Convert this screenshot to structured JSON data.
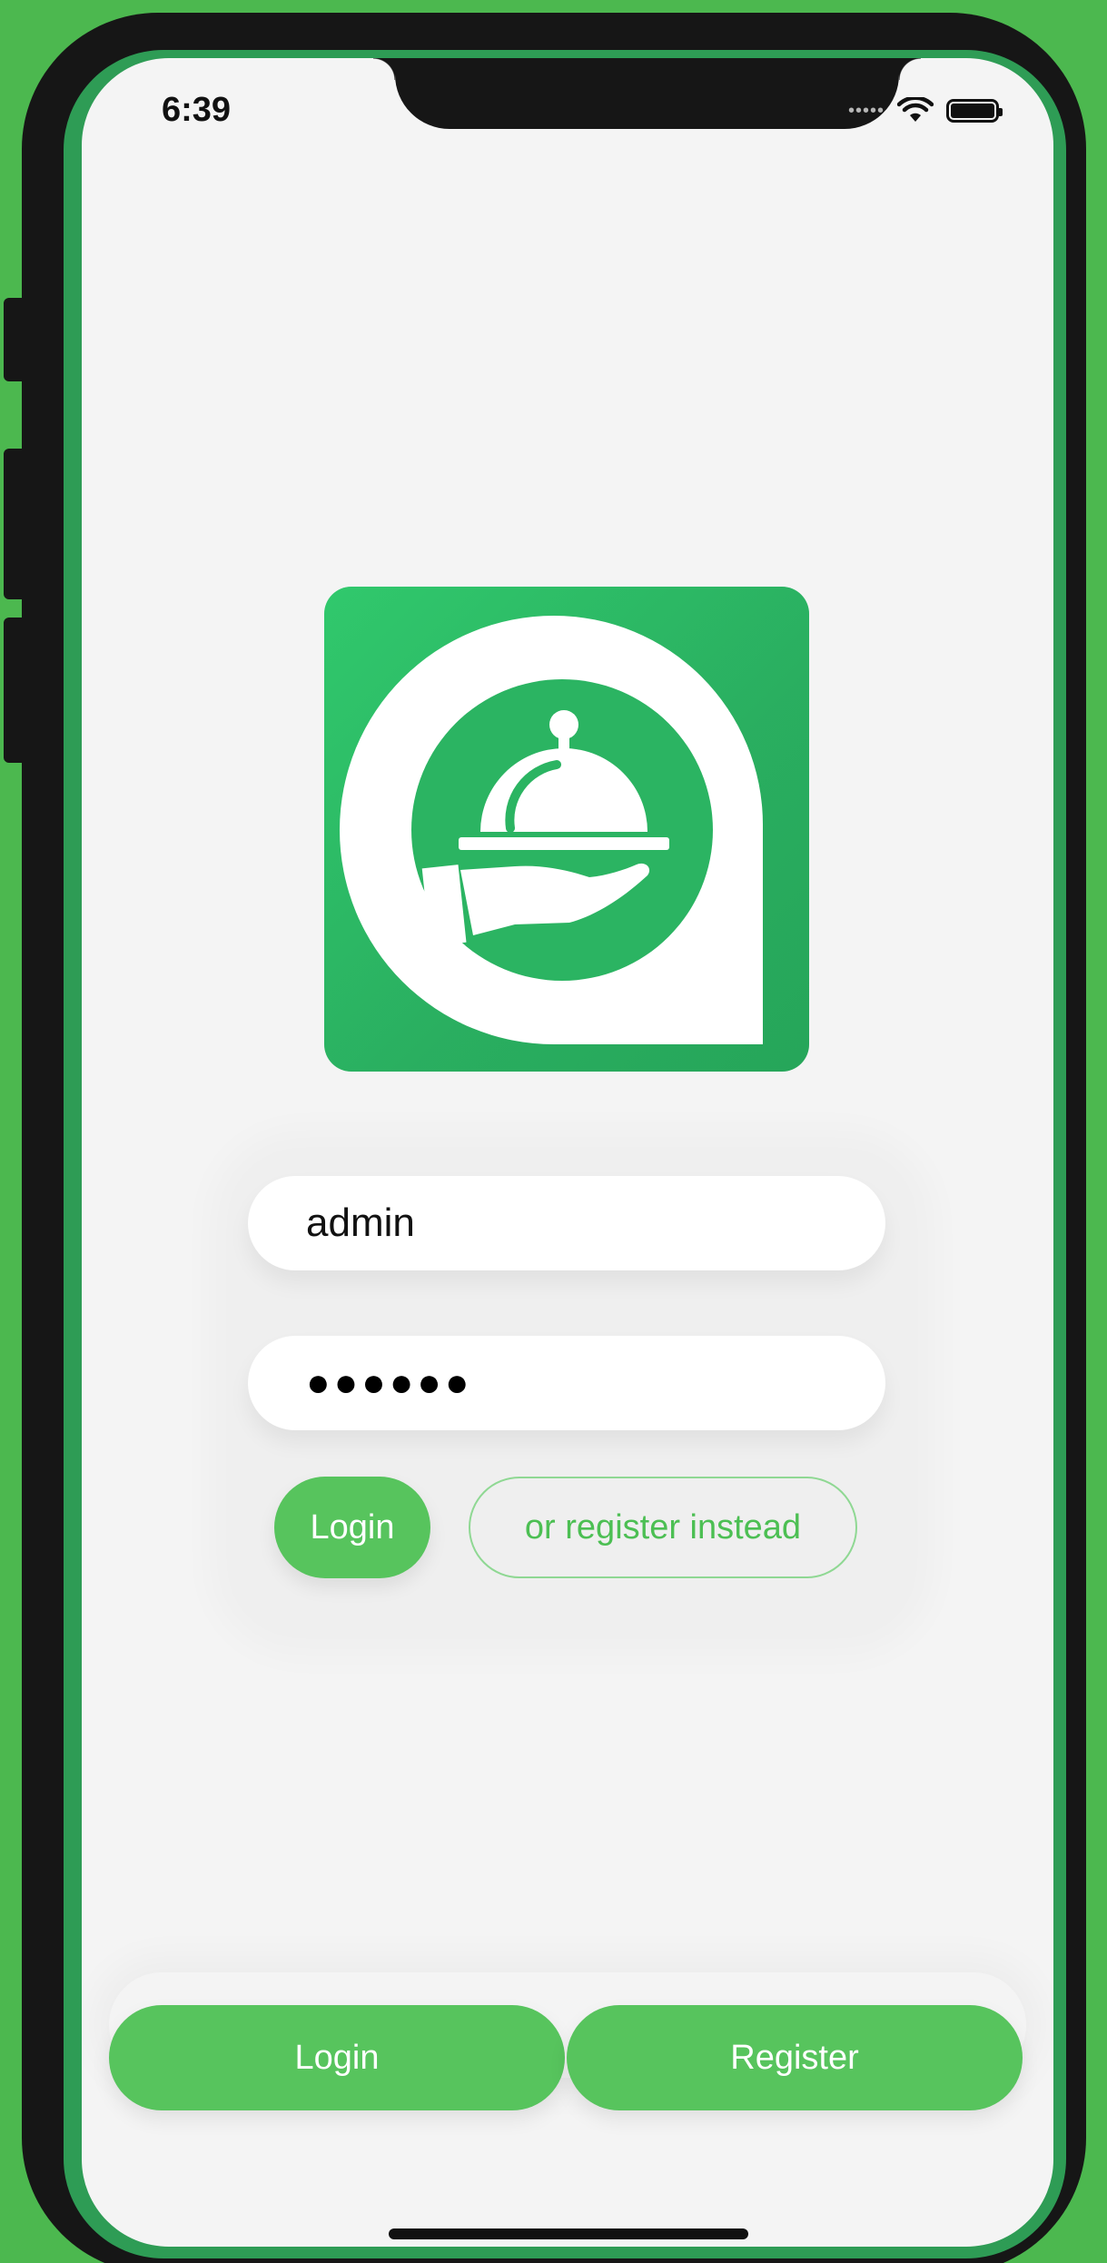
{
  "status_bar": {
    "time": "6:39",
    "icons": [
      "signal-dots-icon",
      "wifi-icon",
      "battery-icon"
    ]
  },
  "logo": {
    "icon": "food-service-cloche-icon",
    "colors": {
      "primary": "#2bb462",
      "background": "#ffffff"
    }
  },
  "form": {
    "username_value": "admin",
    "password_masked": "●●●●●●",
    "login_button_label": "Login",
    "register_link_label": "or register instead"
  },
  "tab_bar": {
    "login_label": "Login",
    "register_label": "Register"
  },
  "colors": {
    "accent": "#57c45d",
    "frame_background": "#4cb84f",
    "screen_background": "#f4f4f4"
  }
}
